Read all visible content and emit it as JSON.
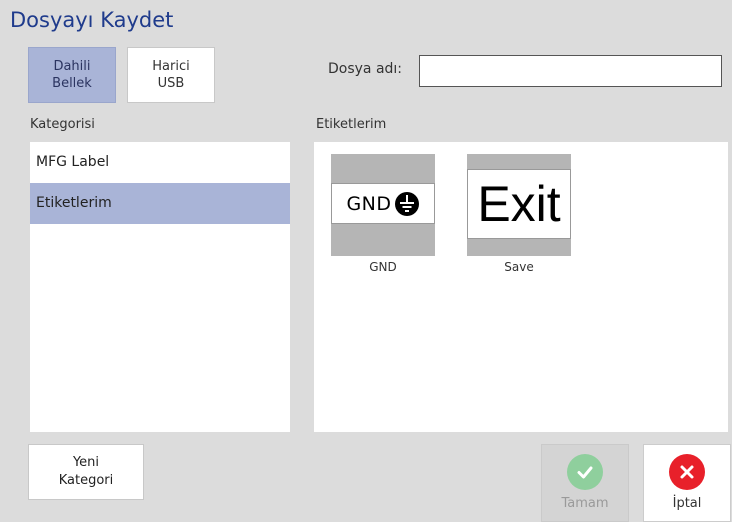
{
  "window": {
    "title": "Dosyayı Kaydet"
  },
  "storage": {
    "internal_label": "Dahili\nBellek",
    "external_label": "Harici\nUSB"
  },
  "filename": {
    "label": "Dosya adı:",
    "value": "",
    "placeholder": ""
  },
  "categories": {
    "header": "Kategorisi",
    "items": [
      {
        "label": "MFG Label",
        "selected": false
      },
      {
        "label": "Etiketlerim",
        "selected": true
      }
    ]
  },
  "labels": {
    "header": "Etiketlerim",
    "items": [
      {
        "preview_text": "GND",
        "caption": "GND",
        "icon": "ground-symbol-icon"
      },
      {
        "preview_text": "Exit",
        "caption": "Save"
      }
    ]
  },
  "buttons": {
    "new_category": "Yeni\nKategori",
    "ok": "Tamam",
    "cancel": "İptal"
  },
  "colors": {
    "accent": "#a9b4d7",
    "title": "#1f3b8c",
    "ok_green": "#8fcf9d",
    "cancel_red": "#e8202a"
  }
}
